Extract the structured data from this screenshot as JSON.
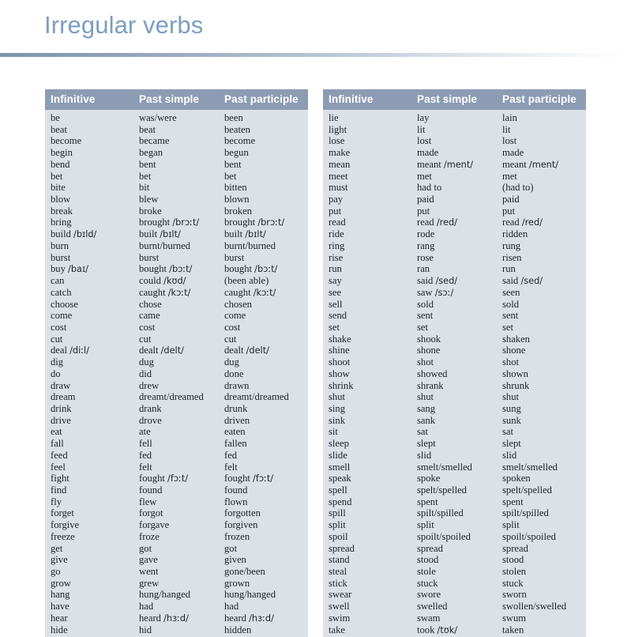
{
  "page": {
    "title": "Irregular verbs",
    "title_color": "#7c9ec0",
    "rule_color": "#7e94ad",
    "header_band_color": "#8c9cb4",
    "table_body_color": "#dce1e8"
  },
  "tables": [
    {
      "id": "table-left",
      "headers": [
        "Infinitive",
        "Past simple",
        "Past participle"
      ],
      "rows": [
        [
          "be",
          "was/were",
          "been"
        ],
        [
          "beat",
          "beat",
          "beaten"
        ],
        [
          "become",
          "became",
          "become"
        ],
        [
          "begin",
          "began",
          "begun"
        ],
        [
          "bend",
          "bent",
          "bent"
        ],
        [
          "bet",
          "bet",
          "bet"
        ],
        [
          "bite",
          "bit",
          "bitten"
        ],
        [
          "blow",
          "blew",
          "blown"
        ],
        [
          "break",
          "broke",
          "broken"
        ],
        [
          "bring",
          "brought /brɔːt/",
          "brought /brɔːt/"
        ],
        [
          "build /bɪld/",
          "built /bɪlt/",
          "built /bɪlt/"
        ],
        [
          "burn",
          "burnt/burned",
          "burnt/burned"
        ],
        [
          "burst",
          "burst",
          "burst"
        ],
        [
          "buy /baɪ/",
          "bought /bɔːt/",
          "bought /bɔːt/"
        ],
        [
          "can",
          "could /kʊd/",
          "(been able)"
        ],
        [
          "catch",
          "caught /kɔːt/",
          "caught /kɔːt/"
        ],
        [
          "choose",
          "chose",
          "chosen"
        ],
        [
          "come",
          "came",
          "come"
        ],
        [
          "cost",
          "cost",
          "cost"
        ],
        [
          "cut",
          "cut",
          "cut"
        ],
        [
          "deal /diːl/",
          "dealt /delt/",
          "dealt /delt/"
        ],
        [
          "dig",
          "dug",
          "dug"
        ],
        [
          "do",
          "did",
          "done"
        ],
        [
          "draw",
          "drew",
          "drawn"
        ],
        [
          "dream",
          "dreamt/dreamed",
          "dreamt/dreamed"
        ],
        [
          "drink",
          "drank",
          "drunk"
        ],
        [
          "drive",
          "drove",
          "driven"
        ],
        [
          "eat",
          "ate",
          "eaten"
        ],
        [
          "fall",
          "fell",
          "fallen"
        ],
        [
          "feed",
          "fed",
          "fed"
        ],
        [
          "feel",
          "felt",
          "felt"
        ],
        [
          "fight",
          "fought /fɔːt/",
          "fought /fɔːt/"
        ],
        [
          "find",
          "found",
          "found"
        ],
        [
          "fly",
          "flew",
          "flown"
        ],
        [
          "forget",
          "forgot",
          "forgotten"
        ],
        [
          "forgive",
          "forgave",
          "forgiven"
        ],
        [
          "freeze",
          "froze",
          "frozen"
        ],
        [
          "get",
          "got",
          "got"
        ],
        [
          "give",
          "gave",
          "given"
        ],
        [
          "go",
          "went",
          "gone/been"
        ],
        [
          "grow",
          "grew",
          "grown"
        ],
        [
          "hang",
          "hung/hanged",
          "hung/hanged"
        ],
        [
          "have",
          "had",
          "had"
        ],
        [
          "hear",
          "heard /hɜːd/",
          "heard /hɜːd/"
        ],
        [
          "hide",
          "hid",
          "hidden"
        ]
      ]
    },
    {
      "id": "table-right",
      "headers": [
        "Infinitive",
        "Past simple",
        "Past participle"
      ],
      "rows": [
        [
          "lie",
          "lay",
          "lain"
        ],
        [
          "light",
          "lit",
          "lit"
        ],
        [
          "lose",
          "lost",
          "lost"
        ],
        [
          "make",
          "made",
          "made"
        ],
        [
          "mean",
          "meant /ment/",
          "meant /ment/"
        ],
        [
          "meet",
          "met",
          "met"
        ],
        [
          "must",
          "had to",
          "(had to)"
        ],
        [
          "pay",
          "paid",
          "paid"
        ],
        [
          "put",
          "put",
          "put"
        ],
        [
          "read",
          "read /red/",
          "read /red/"
        ],
        [
          "ride",
          "rode",
          "ridden"
        ],
        [
          "ring",
          "rang",
          "rung"
        ],
        [
          "rise",
          "rose",
          "risen"
        ],
        [
          "run",
          "ran",
          "run"
        ],
        [
          "say",
          "said /sed/",
          "said /sed/"
        ],
        [
          "see",
          "saw /sɔː/",
          "seen"
        ],
        [
          "sell",
          "sold",
          "sold"
        ],
        [
          "send",
          "sent",
          "sent"
        ],
        [
          "set",
          "set",
          "set"
        ],
        [
          "shake",
          "shook",
          "shaken"
        ],
        [
          "shine",
          "shone",
          "shone"
        ],
        [
          "shoot",
          "shot",
          "shot"
        ],
        [
          "show",
          "showed",
          "shown"
        ],
        [
          "shrink",
          "shrank",
          "shrunk"
        ],
        [
          "shut",
          "shut",
          "shut"
        ],
        [
          "sing",
          "sang",
          "sung"
        ],
        [
          "sink",
          "sank",
          "sunk"
        ],
        [
          "sit",
          "sat",
          "sat"
        ],
        [
          "sleep",
          "slept",
          "slept"
        ],
        [
          "slide",
          "slid",
          "slid"
        ],
        [
          "smell",
          "smelt/smelled",
          "smelt/smelled"
        ],
        [
          "speak",
          "spoke",
          "spoken"
        ],
        [
          "spell",
          "spelt/spelled",
          "spelt/spelled"
        ],
        [
          "spend",
          "spent",
          "spent"
        ],
        [
          "spill",
          "spilt/spilled",
          "spilt/spilled"
        ],
        [
          "split",
          "split",
          "split"
        ],
        [
          "spoil",
          "spoilt/spoiled",
          "spoilt/spoiled"
        ],
        [
          "spread",
          "spread",
          "spread"
        ],
        [
          "stand",
          "stood",
          "stood"
        ],
        [
          "steal",
          "stole",
          "stolen"
        ],
        [
          "stick",
          "stuck",
          "stuck"
        ],
        [
          "swear",
          "swore",
          "sworn"
        ],
        [
          "swell",
          "swelled",
          "swollen/swelled"
        ],
        [
          "swim",
          "swam",
          "swum"
        ],
        [
          "take",
          "took /tʊk/",
          "taken"
        ]
      ]
    }
  ]
}
